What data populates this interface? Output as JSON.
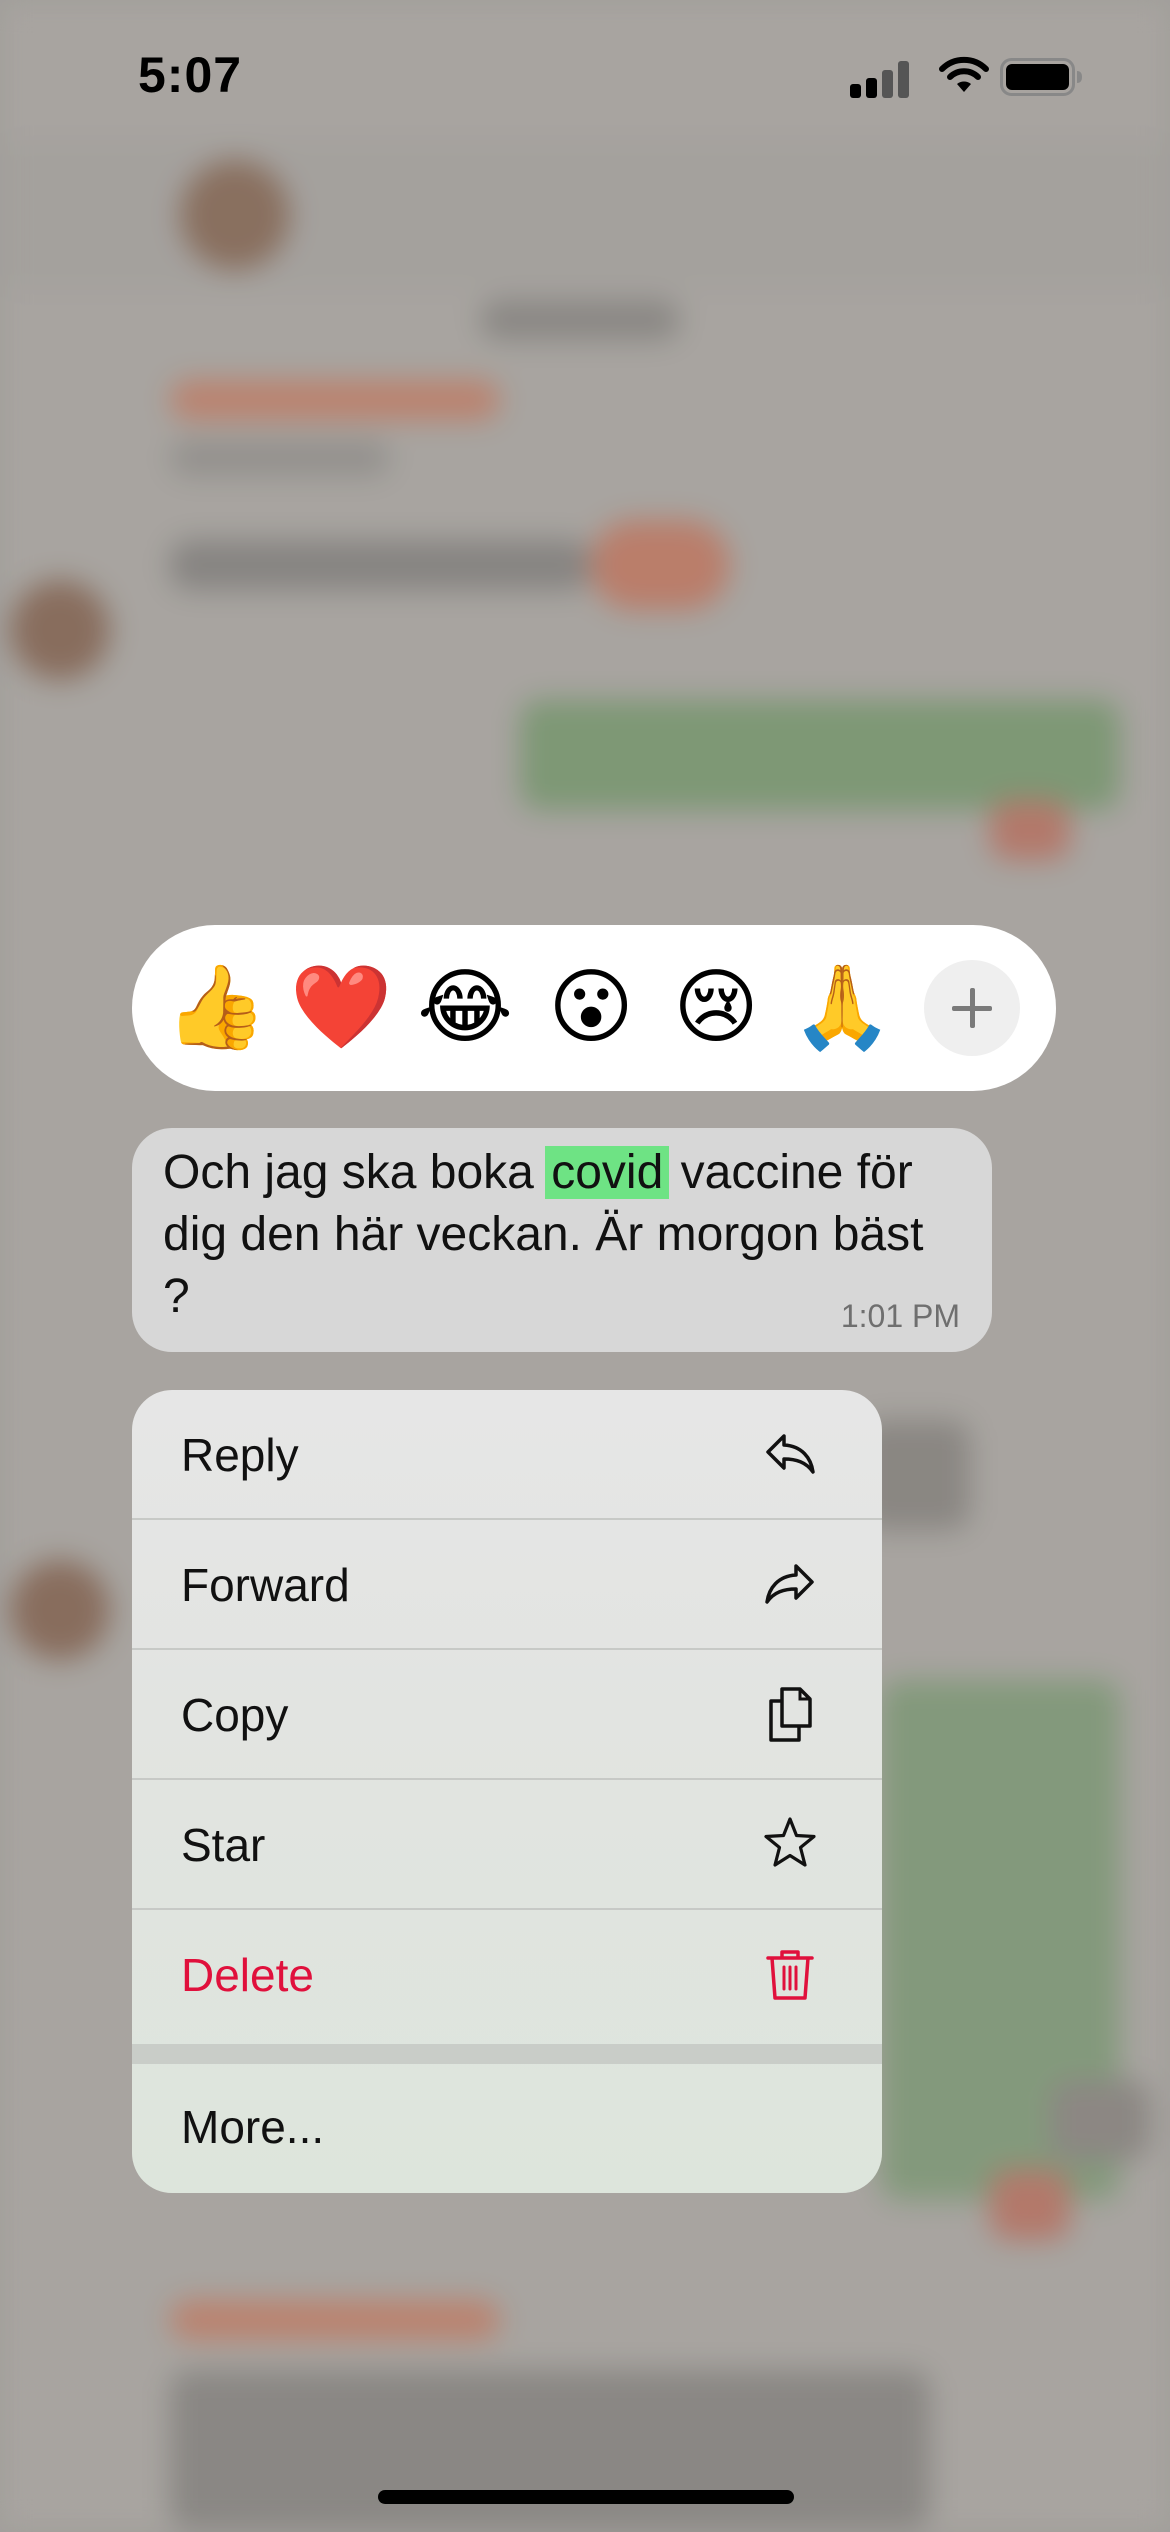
{
  "status_bar": {
    "time": "5:07"
  },
  "reactions": {
    "items": [
      {
        "name": "thumbs-up",
        "glyph": "👍"
      },
      {
        "name": "red-heart",
        "glyph": "❤️"
      },
      {
        "name": "tears-of-joy",
        "glyph": "😂"
      },
      {
        "name": "surprised-face",
        "glyph": "😮"
      },
      {
        "name": "crying-face",
        "glyph": "😢"
      },
      {
        "name": "folded-hands",
        "glyph": "🙏"
      }
    ],
    "more_icon": "plus-icon"
  },
  "message": {
    "text_before": "Och jag ska boka ",
    "highlighted": "covid",
    "text_after": " vaccine för dig den här veckan. Är morgon bäst ?",
    "time": "1:01 PM",
    "highlight_color": "#6ee384"
  },
  "menu": {
    "items": [
      {
        "label": "Reply",
        "icon": "reply-icon"
      },
      {
        "label": "Forward",
        "icon": "forward-icon"
      },
      {
        "label": "Copy",
        "icon": "copy-icon"
      },
      {
        "label": "Star",
        "icon": "star-icon"
      },
      {
        "label": "Delete",
        "icon": "trash-icon"
      }
    ],
    "more_label": "More...",
    "danger_color": "#e0103c"
  }
}
